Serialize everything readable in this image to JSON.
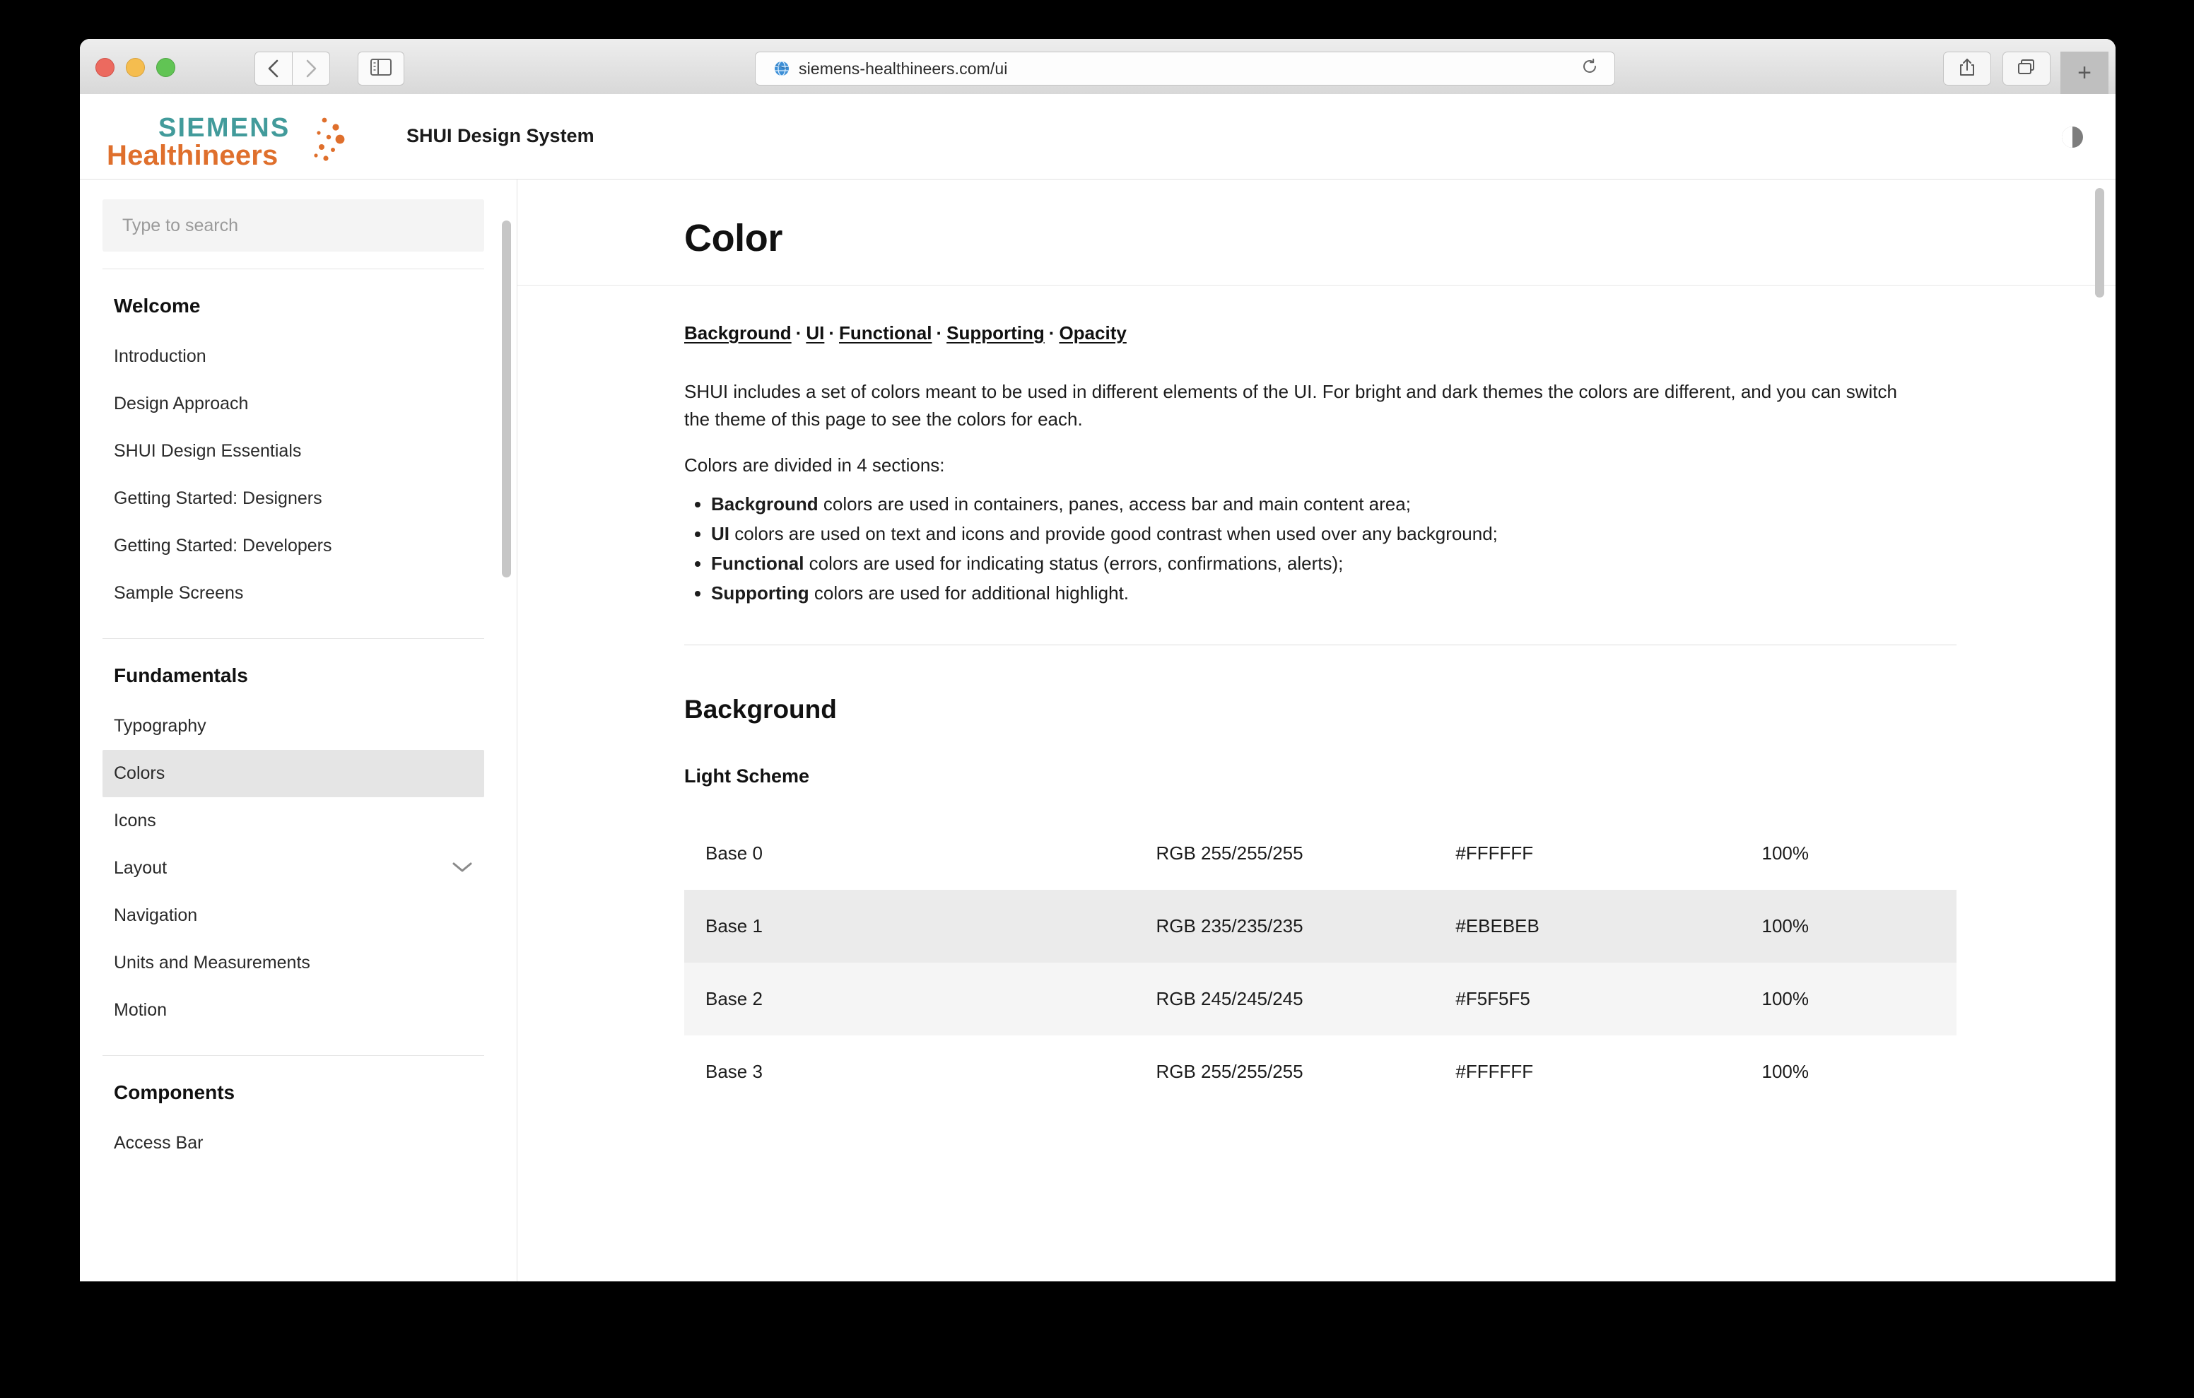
{
  "browser": {
    "url": "siemens-healthineers.com/ui",
    "icons": {
      "back": "back-chevron-icon",
      "forward": "forward-chevron-icon",
      "sidebar": "sidebar-toggle-icon",
      "favicon": "globe-favicon-icon",
      "reload": "reload-icon",
      "share": "share-icon",
      "tabs": "tab-overview-icon",
      "new_tab": "+"
    }
  },
  "header": {
    "logo_top": "SIEMENS",
    "logo_bottom": "Healthineers",
    "app_title": "SHUI Design System",
    "theme_toggle": "contrast-toggle-icon",
    "colors": {
      "teal": "#429B9B",
      "orange": "#DF6F2C"
    }
  },
  "sidebar": {
    "search_placeholder": "Type to search",
    "groups": [
      {
        "title": "Welcome",
        "items": [
          {
            "label": "Introduction",
            "active": false,
            "chevron": false
          },
          {
            "label": "Design Approach",
            "active": false,
            "chevron": false
          },
          {
            "label": "SHUI Design Essentials",
            "active": false,
            "chevron": false
          },
          {
            "label": "Getting Started: Designers",
            "active": false,
            "chevron": false
          },
          {
            "label": "Getting Started: Developers",
            "active": false,
            "chevron": false
          },
          {
            "label": "Sample Screens",
            "active": false,
            "chevron": false
          }
        ]
      },
      {
        "title": "Fundamentals",
        "items": [
          {
            "label": "Typography",
            "active": false,
            "chevron": false
          },
          {
            "label": "Colors",
            "active": true,
            "chevron": false
          },
          {
            "label": "Icons",
            "active": false,
            "chevron": false
          },
          {
            "label": "Layout",
            "active": false,
            "chevron": true
          },
          {
            "label": "Navigation",
            "active": false,
            "chevron": false
          },
          {
            "label": "Units and Measurements",
            "active": false,
            "chevron": false
          },
          {
            "label": "Motion",
            "active": false,
            "chevron": false
          }
        ]
      },
      {
        "title": "Components",
        "items": [
          {
            "label": "Access Bar",
            "active": false,
            "chevron": false
          }
        ]
      }
    ]
  },
  "main": {
    "page_title": "Color",
    "anchors": [
      "Background",
      "UI",
      "Functional",
      "Supporting",
      "Opacity"
    ],
    "anchor_separator": "·",
    "intro": "SHUI includes a set of colors meant to be used in different elements of the UI. For bright and dark themes the colors are different, and you can switch the theme of this page to see the colors for each.",
    "intro2": "Colors are divided in 4 sections:",
    "bullets": [
      {
        "term": "Background",
        "rest": " colors are used in containers, panes, access bar and main content area;"
      },
      {
        "term": "UI",
        "rest": " colors are used on text and icons and provide good contrast when used over any background;"
      },
      {
        "term": "Functional",
        "rest": " colors are used for indicating status (errors, confirmations, alerts);"
      },
      {
        "term": "Supporting",
        "rest": " colors are used for additional highlight."
      }
    ],
    "section_title": "Background",
    "subsection_title": "Light Scheme",
    "table": {
      "rows": [
        {
          "name": "Base 0",
          "rgb": "RGB 255/255/255",
          "hex": "#FFFFFF",
          "opacity": "100%",
          "row_bg": "#FFFFFF"
        },
        {
          "name": "Base 1",
          "rgb": "RGB 235/235/235",
          "hex": "#EBEBEB",
          "opacity": "100%",
          "row_bg": "#EBEBEB"
        },
        {
          "name": "Base 2",
          "rgb": "RGB 245/245/245",
          "hex": "#F5F5F5",
          "opacity": "100%",
          "row_bg": "#F5F5F5"
        },
        {
          "name": "Base 3",
          "rgb": "RGB 255/255/255",
          "hex": "#FFFFFF",
          "opacity": "100%",
          "row_bg": "#FFFFFF"
        }
      ]
    }
  }
}
